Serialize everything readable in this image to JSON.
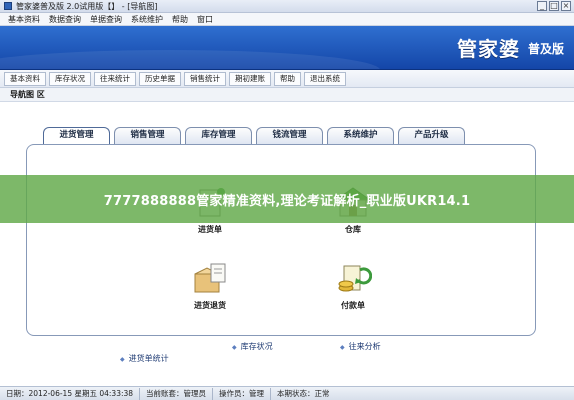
{
  "window": {
    "title": "管家婆普及版 2.0试用版【】 - [导航图]",
    "controls": [
      "_",
      "□",
      "×"
    ]
  },
  "menubar": {
    "items": [
      "基本资料",
      "数据查询",
      "单据查询",
      "系统维护",
      "帮助",
      "窗口"
    ]
  },
  "banner": {
    "logo": "管家婆",
    "tag": "普及版",
    "colors": {
      "top": "#2f6fd0",
      "bottom": "#1446a8"
    }
  },
  "toolbar": {
    "buttons": [
      "基本资料",
      "库存状况",
      "往来统计",
      "历史单据",
      "销售统计",
      "期初建账",
      "帮助",
      "退出系统"
    ]
  },
  "navbar": {
    "label": "导航图 区"
  },
  "tabs": [
    {
      "label": "进货管理",
      "active": true
    },
    {
      "label": "销售管理",
      "active": false
    },
    {
      "label": "库存管理",
      "active": false
    },
    {
      "label": "钱流管理",
      "active": false
    },
    {
      "label": "系统维护",
      "active": false
    },
    {
      "label": "产品升级",
      "active": false
    }
  ],
  "modules": {
    "purchase_order": {
      "label": "进货单",
      "icon": "purchase-order-icon"
    },
    "warehouse": {
      "label": "仓库",
      "icon": "warehouse-icon"
    },
    "purchase_return": {
      "label": "进货退货",
      "icon": "purchase-return-icon"
    },
    "payment_order": {
      "label": "付款单",
      "icon": "payment-order-icon"
    }
  },
  "links": {
    "inventory_status": "库存状况",
    "payables_analysis": "往来分析",
    "purchase_stats": "进货单统计"
  },
  "statusbar": {
    "date": "日期：2012-06-15 星期五 04:33:38",
    "company": "当前账套：管理员",
    "operator": "操作员：管理",
    "period": "本期状态：正常"
  },
  "overlay": {
    "text": "7777888888管家精准资料,理论考证解析_职业版UKR14.1",
    "color": "#60a848"
  }
}
